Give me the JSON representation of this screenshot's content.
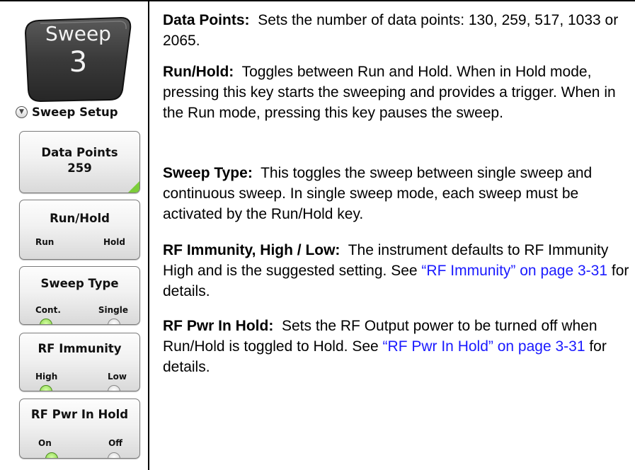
{
  "hardkey": {
    "name": "Sweep",
    "number": "3"
  },
  "menu": {
    "title": "Sweep Setup"
  },
  "softkeys": {
    "data_points": {
      "title": "Data Points",
      "value": "259"
    },
    "run_hold": {
      "title": "Run/Hold",
      "left": "Run",
      "right": "Hold",
      "active": "left"
    },
    "sweep_type": {
      "title": "Sweep Type",
      "left": "Cont.",
      "right": "Single",
      "active": "left"
    },
    "rf_immunity": {
      "title": "RF Immunity",
      "left": "High",
      "right": "Low",
      "active": "left"
    },
    "rf_pwr_in_hold": {
      "title": "RF Pwr In Hold",
      "left": "On",
      "right": "Off",
      "active": "left"
    }
  },
  "colors": {
    "led_on": "#7ccd3a",
    "link": "#1a1aff",
    "hardkey_bg": "#3a3a3a"
  },
  "descriptions": {
    "data_points": {
      "term": "Data Points:",
      "text": "Sets the number of data points: 130, 259, 517, 1033 or 2065."
    },
    "run_hold": {
      "term": "Run/Hold:",
      "text": "Toggles between Run and Hold. When in Hold mode, pressing this key starts the sweeping and provides a trigger. When in the Run mode, pressing this key pauses the sweep."
    },
    "sweep_type": {
      "term": "Sweep Type:",
      "text": "This toggles the sweep between single sweep and continuous sweep. In single sweep mode, each sweep must be activated by the Run/Hold key."
    },
    "rf_immunity": {
      "term": "RF Immunity, High / Low:",
      "text": "The instrument defaults to RF Immunity High and is the suggested setting. See",
      "link": "“RF Immunity” on page 3-31",
      "after": "for details."
    },
    "rf_pwr_in_hold": {
      "term": "RF Pwr In Hold:",
      "text": "Sets the RF Output power to be turned off when Run/Hold is toggled to Hold. See",
      "link": "“RF Pwr In Hold” on page 3-31",
      "after": "for details."
    }
  }
}
